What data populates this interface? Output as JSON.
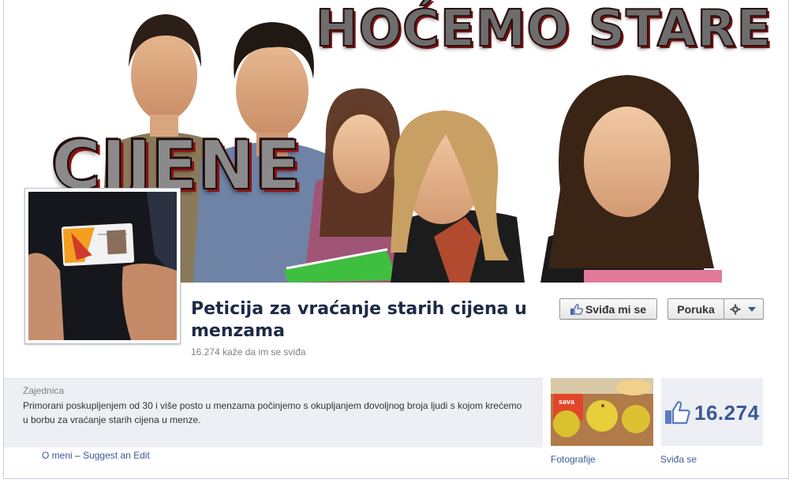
{
  "cover": {
    "headline": "HOĆEMO STARE",
    "subheadline": "CIJENE"
  },
  "page": {
    "title": "Peticija za vraćanje starih cijena u menzama",
    "likes_line": "16.274 kaže da im se sviđa"
  },
  "buttons": {
    "like_label": "Sviđa mi se",
    "message_label": "Poruka",
    "settings_icon": "gear-icon"
  },
  "about": {
    "category": "Zajednica",
    "description": "Primorani poskupljenjem od 30 i više posto u menzama počinjemo s okupljanjem dovoljnog broja ljudi s kojom krećemo u borbu za vraćanje starih cijena u menze."
  },
  "links": {
    "about_me": "O meni",
    "separator": "–",
    "suggest_edit": "Suggest an Edit"
  },
  "tiles": {
    "photos_label": "Fotografije",
    "photo_brand": "sava",
    "likes_count": "16.274",
    "likes_label": "Sviđa se"
  },
  "colors": {
    "facebook_blue": "#3b5998",
    "title_navy": "#1c2a47",
    "panel_bg": "#edeff4"
  }
}
